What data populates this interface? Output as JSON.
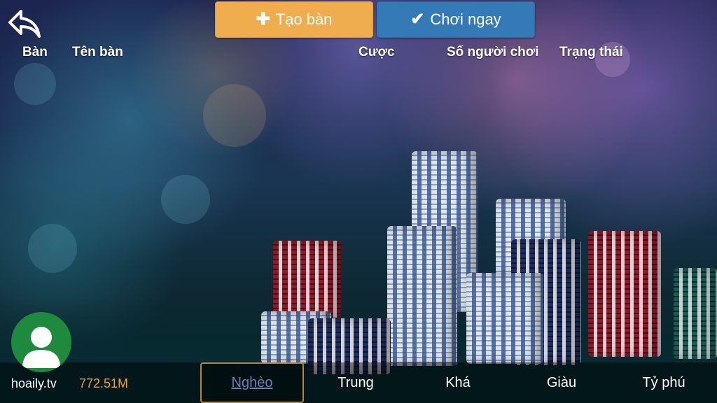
{
  "top_bar": {
    "create_table_label": "Tạo bàn",
    "play_now_label": "Chơi ngay",
    "create_icon": "plus-icon",
    "play_icon": "checkmark-icon",
    "back_icon": "back-arrow-icon"
  },
  "table_headers": {
    "table": "Bàn",
    "table_name": "Tên bàn",
    "bet": "Cược",
    "players": "Số người chơi",
    "status": "Trạng thái"
  },
  "user": {
    "username": "hoaily.tv",
    "balance": "772.51M",
    "avatar_icon": "user-avatar-icon"
  },
  "tiers": [
    {
      "label": "Nghèo",
      "active": true
    },
    {
      "label": "Trung",
      "active": false
    },
    {
      "label": "Khá",
      "active": false
    },
    {
      "label": "Giàu",
      "active": false
    },
    {
      "label": "Tỷ phú",
      "active": false
    }
  ],
  "colors": {
    "create_button": "#f0ad4e",
    "play_button": "#337ab7",
    "balance": "#f0a030",
    "avatar_bg": "#1e8a3e",
    "active_tab_border": "#b5892a"
  }
}
